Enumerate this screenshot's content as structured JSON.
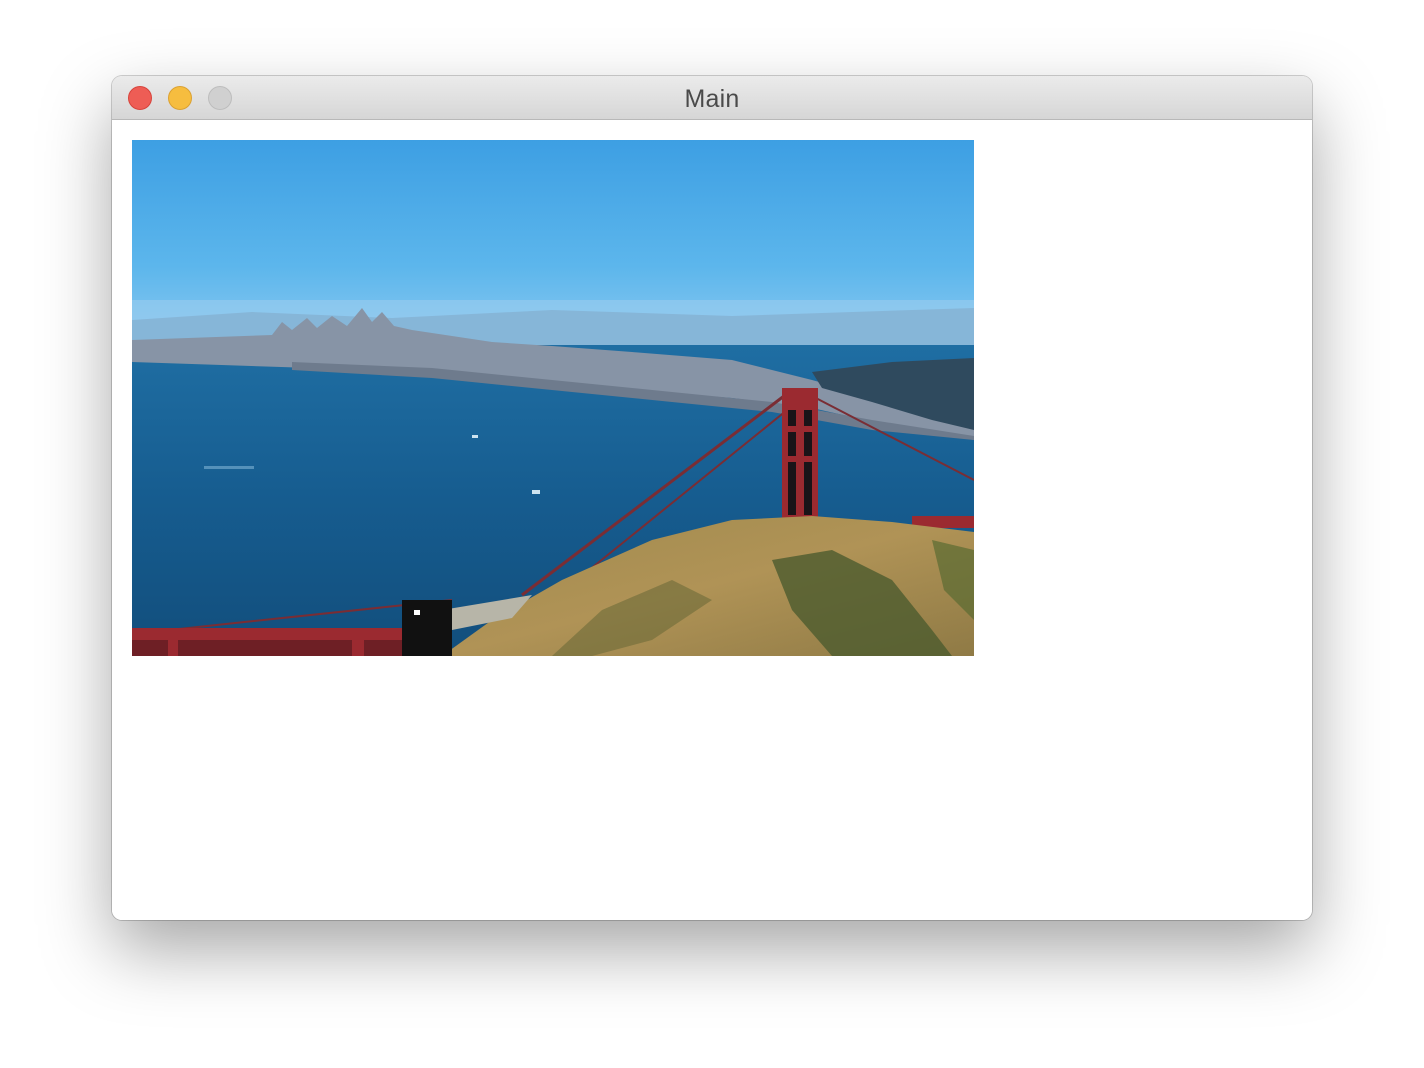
{
  "window": {
    "title": "Main",
    "controls": {
      "close_color": "#ee5d55",
      "minimize_color": "#f6bd3f",
      "zoom_color": "#d0d0d0"
    }
  },
  "image": {
    "subject": "golden-gate-bridge-bay-view"
  }
}
